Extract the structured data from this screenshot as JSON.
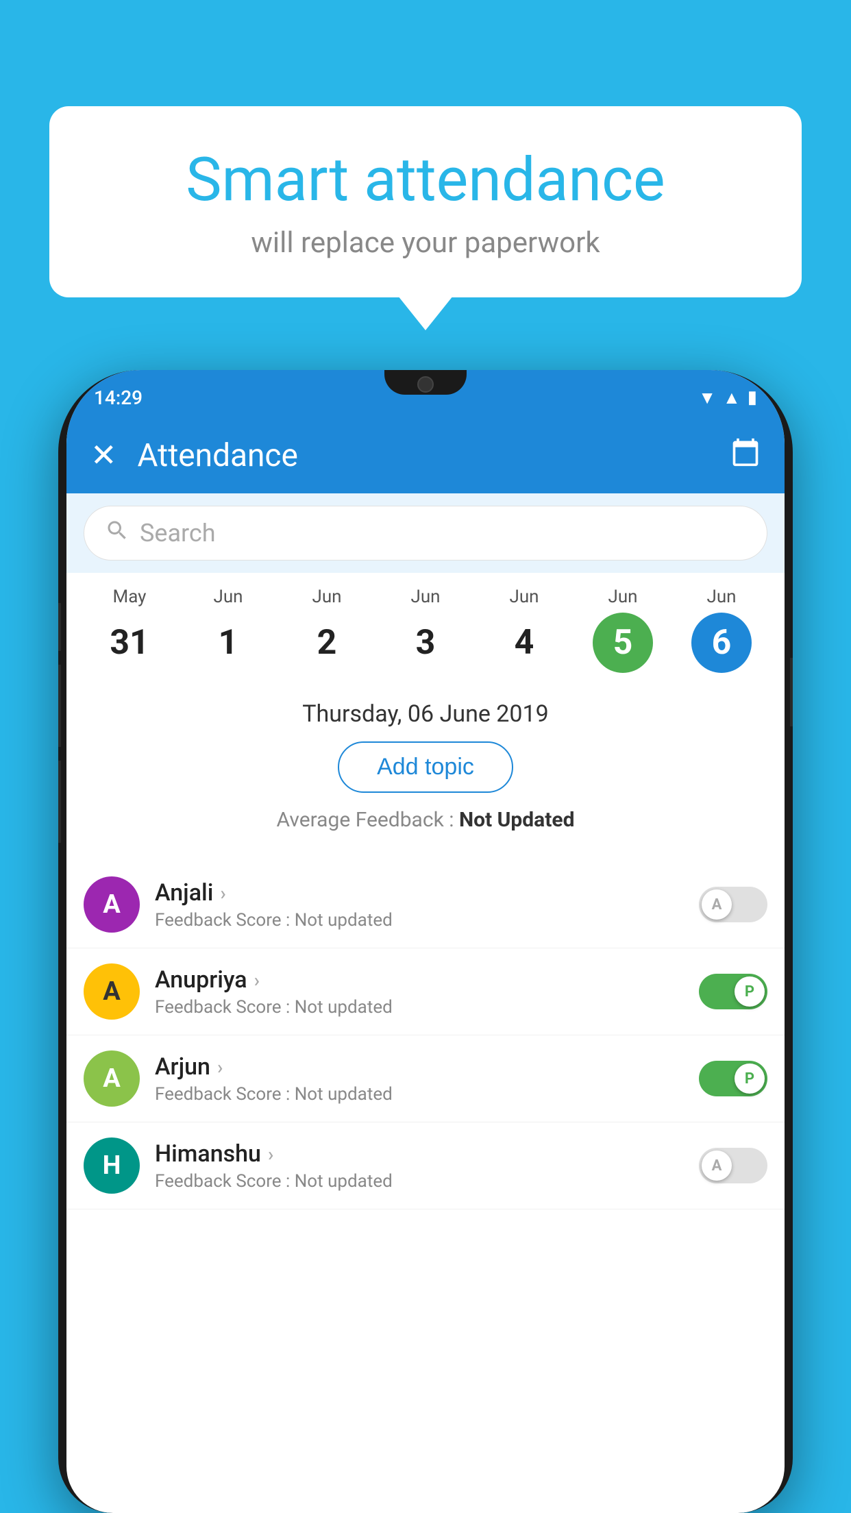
{
  "background_color": "#29b6e8",
  "speech_bubble": {
    "title": "Smart attendance",
    "subtitle": "will replace your paperwork"
  },
  "status_bar": {
    "time": "14:29",
    "icons": [
      "wifi",
      "signal",
      "battery"
    ]
  },
  "app_bar": {
    "title": "Attendance",
    "close_label": "×",
    "calendar_label": "📅"
  },
  "search": {
    "placeholder": "Search"
  },
  "calendar": {
    "columns": [
      {
        "month": "May",
        "day": "31",
        "active": false
      },
      {
        "month": "Jun",
        "day": "1",
        "active": false
      },
      {
        "month": "Jun",
        "day": "2",
        "active": false
      },
      {
        "month": "Jun",
        "day": "3",
        "active": false
      },
      {
        "month": "Jun",
        "day": "4",
        "active": false
      },
      {
        "month": "Jun",
        "day": "5",
        "active": "green"
      },
      {
        "month": "Jun",
        "day": "6",
        "active": "blue"
      }
    ]
  },
  "selected_date": "Thursday, 06 June 2019",
  "add_topic_label": "Add topic",
  "avg_feedback_label": "Average Feedback : ",
  "avg_feedback_value": "Not Updated",
  "students": [
    {
      "name": "Anjali",
      "avatar_letter": "A",
      "avatar_class": "avatar-purple",
      "feedback_label": "Feedback Score : ",
      "feedback_value": "Not updated",
      "toggle_state": "off",
      "toggle_letter": "A"
    },
    {
      "name": "Anupriya",
      "avatar_letter": "A",
      "avatar_class": "avatar-yellow",
      "feedback_label": "Feedback Score : ",
      "feedback_value": "Not updated",
      "toggle_state": "on",
      "toggle_letter": "P"
    },
    {
      "name": "Arjun",
      "avatar_letter": "A",
      "avatar_class": "avatar-green",
      "feedback_label": "Feedback Score : ",
      "feedback_value": "Not updated",
      "toggle_state": "on",
      "toggle_letter": "P"
    },
    {
      "name": "Himanshu",
      "avatar_letter": "H",
      "avatar_class": "avatar-teal",
      "feedback_label": "Feedback Score : ",
      "feedback_value": "Not updated",
      "toggle_state": "off",
      "toggle_letter": "A"
    }
  ]
}
